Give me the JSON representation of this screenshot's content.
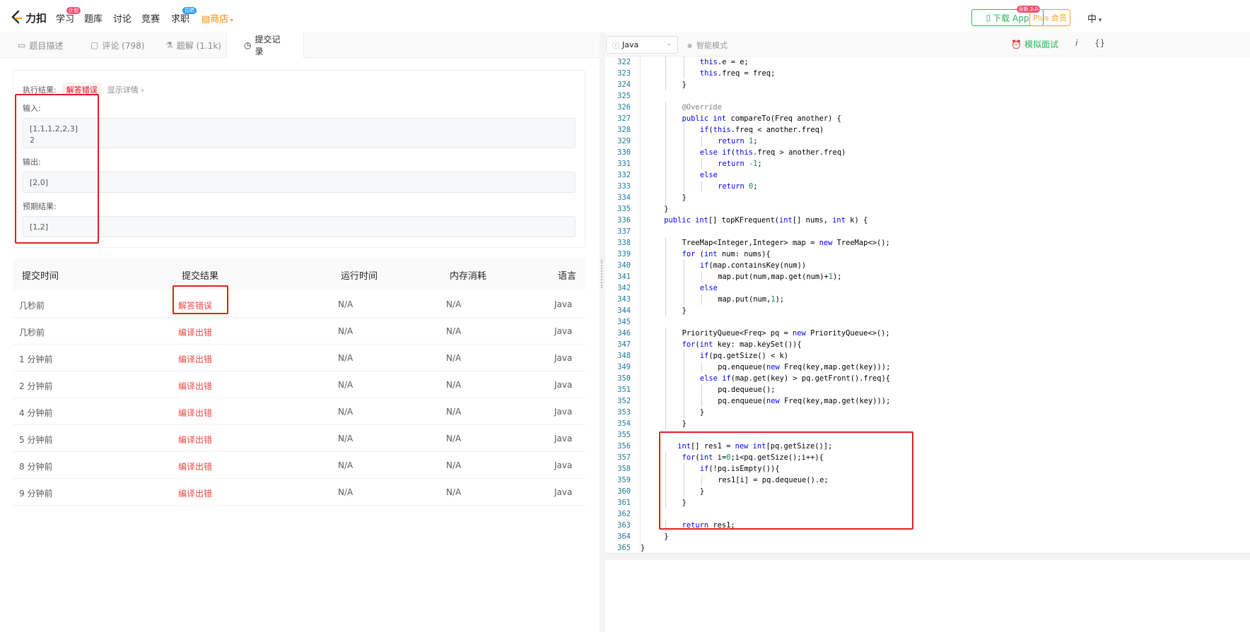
{
  "nav": {
    "logo_text": "力扣",
    "items": [
      {
        "label": "学习",
        "badge": "计划"
      },
      {
        "label": "题库"
      },
      {
        "label": "讨论"
      },
      {
        "label": "竞赛"
      },
      {
        "label": "求职",
        "badge": "招聘"
      },
      {
        "label": "商店"
      }
    ],
    "download_label": "下载 App",
    "download_badge": "全新 2.0",
    "plus_label": "Plus 会员",
    "lang_label": "中"
  },
  "tabs": [
    {
      "label": "题目描述",
      "icon": "document-icon"
    },
    {
      "label": "评论 (798)",
      "icon": "comment-icon"
    },
    {
      "label": "题解 (1.1k)",
      "icon": "flask-icon"
    },
    {
      "label": "提交记录",
      "icon": "clock-icon",
      "active": true
    }
  ],
  "result": {
    "exec_label": "执行结果:",
    "status": "解答错误",
    "detail_link": "显示详情 ›",
    "input_label": "输入:",
    "input_value": "[1,1,1,2,2,3]\n2",
    "output_label": "输出:",
    "output_value": "[2,0]",
    "expected_label": "预期结果:",
    "expected_value": "[1,2]"
  },
  "table": {
    "headers": [
      "提交时间",
      "提交结果",
      "运行时间",
      "内存消耗",
      "语言"
    ],
    "rows": [
      [
        "几秒前",
        "解答错误",
        "N/A",
        "N/A",
        "Java"
      ],
      [
        "几秒前",
        "编译出错",
        "N/A",
        "N/A",
        "Java"
      ],
      [
        "1 分钟前",
        "编译出错",
        "N/A",
        "N/A",
        "Java"
      ],
      [
        "2 分钟前",
        "编译出错",
        "N/A",
        "N/A",
        "Java"
      ],
      [
        "4 分钟前",
        "编译出错",
        "N/A",
        "N/A",
        "Java"
      ],
      [
        "5 分钟前",
        "编译出错",
        "N/A",
        "N/A",
        "Java"
      ],
      [
        "8 分钟前",
        "编译出错",
        "N/A",
        "N/A",
        "Java"
      ],
      [
        "9 分钟前",
        "编译出错",
        "N/A",
        "N/A",
        "Java"
      ]
    ]
  },
  "editor": {
    "language": "Java",
    "smart_mode": "智能模式",
    "mock_interview": "模拟面试",
    "info_icon": "i",
    "braces_icon": "{}",
    "lines": [
      {
        "n": "322",
        "indent": 3,
        "code": "this.e = e;"
      },
      {
        "n": "323",
        "indent": 3,
        "code": "this.freq = freq;"
      },
      {
        "n": "324",
        "indent": 2,
        "code": "}"
      },
      {
        "n": "325",
        "indent": 0,
        "code": ""
      },
      {
        "n": "326",
        "indent": 2,
        "code": "@Override"
      },
      {
        "n": "327",
        "indent": 2,
        "code": "public int compareTo(Freq another) {"
      },
      {
        "n": "328",
        "indent": 3,
        "code": "if(this.freq < another.freq)"
      },
      {
        "n": "329",
        "indent": 4,
        "code": "return 1;"
      },
      {
        "n": "330",
        "indent": 3,
        "code": "else if(this.freq > another.freq)"
      },
      {
        "n": "331",
        "indent": 4,
        "code": "return -1;"
      },
      {
        "n": "332",
        "indent": 3,
        "code": "else"
      },
      {
        "n": "333",
        "indent": 4,
        "code": "return 0;"
      },
      {
        "n": "334",
        "indent": 2,
        "code": "}"
      },
      {
        "n": "335",
        "indent": 1,
        "code": "}"
      },
      {
        "n": "336",
        "indent": 1,
        "code": "public int[] topKFrequent(int[] nums, int k) {"
      },
      {
        "n": "337",
        "indent": 0,
        "code": ""
      },
      {
        "n": "338",
        "indent": 2,
        "code": "TreeMap<Integer,Integer> map = new TreeMap<>();"
      },
      {
        "n": "339",
        "indent": 2,
        "code": "for (int num: nums){"
      },
      {
        "n": "340",
        "indent": 3,
        "code": "if(map.containsKey(num))"
      },
      {
        "n": "341",
        "indent": 4,
        "code": "map.put(num,map.get(num)+1);"
      },
      {
        "n": "342",
        "indent": 3,
        "code": "else"
      },
      {
        "n": "343",
        "indent": 4,
        "code": "map.put(num,1);"
      },
      {
        "n": "344",
        "indent": 2,
        "code": "}"
      },
      {
        "n": "345",
        "indent": 0,
        "code": ""
      },
      {
        "n": "346",
        "indent": 2,
        "code": "PriorityQueue<Freq> pq = new PriorityQueue<>();"
      },
      {
        "n": "347",
        "indent": 2,
        "code": "for(int key: map.keySet()){"
      },
      {
        "n": "348",
        "indent": 3,
        "code": "if(pq.getSize() < k)"
      },
      {
        "n": "349",
        "indent": 4,
        "code": "pq.enqueue(new Freq(key,map.get(key)));"
      },
      {
        "n": "350",
        "indent": 3,
        "code": "else if(map.get(key) > pq.getFront().freq){"
      },
      {
        "n": "351",
        "indent": 4,
        "code": "pq.dequeue();"
      },
      {
        "n": "352",
        "indent": 4,
        "code": "pq.enqueue(new Freq(key,map.get(key)));"
      },
      {
        "n": "353",
        "indent": 3,
        "code": "}"
      },
      {
        "n": "354",
        "indent": 2,
        "code": "}"
      },
      {
        "n": "355",
        "indent": 0,
        "code": ""
      },
      {
        "n": "356",
        "indent": 1.75,
        "code": "int[] res1 = new int[pq.getSize()];"
      },
      {
        "n": "357",
        "indent": 2,
        "code": "for(int i=0;i<pq.getSize();i++){"
      },
      {
        "n": "358",
        "indent": 3,
        "code": "if(!pq.isEmpty()){"
      },
      {
        "n": "359",
        "indent": 4,
        "code": "res1[i] = pq.dequeue().e;"
      },
      {
        "n": "360",
        "indent": 3,
        "code": "}"
      },
      {
        "n": "361",
        "indent": 2,
        "code": "}"
      },
      {
        "n": "362",
        "indent": 0,
        "code": ""
      },
      {
        "n": "363",
        "indent": 2,
        "code": "return res1;"
      },
      {
        "n": "364",
        "indent": 1,
        "code": "}"
      },
      {
        "n": "365",
        "indent": 0,
        "code": "}"
      }
    ]
  },
  "colors": {
    "accent_green": "#2db55d",
    "error_red": "#ef4743",
    "annotation_red": "#e02020",
    "keyword_blue": "#0000ff",
    "number_green": "#09885a"
  }
}
